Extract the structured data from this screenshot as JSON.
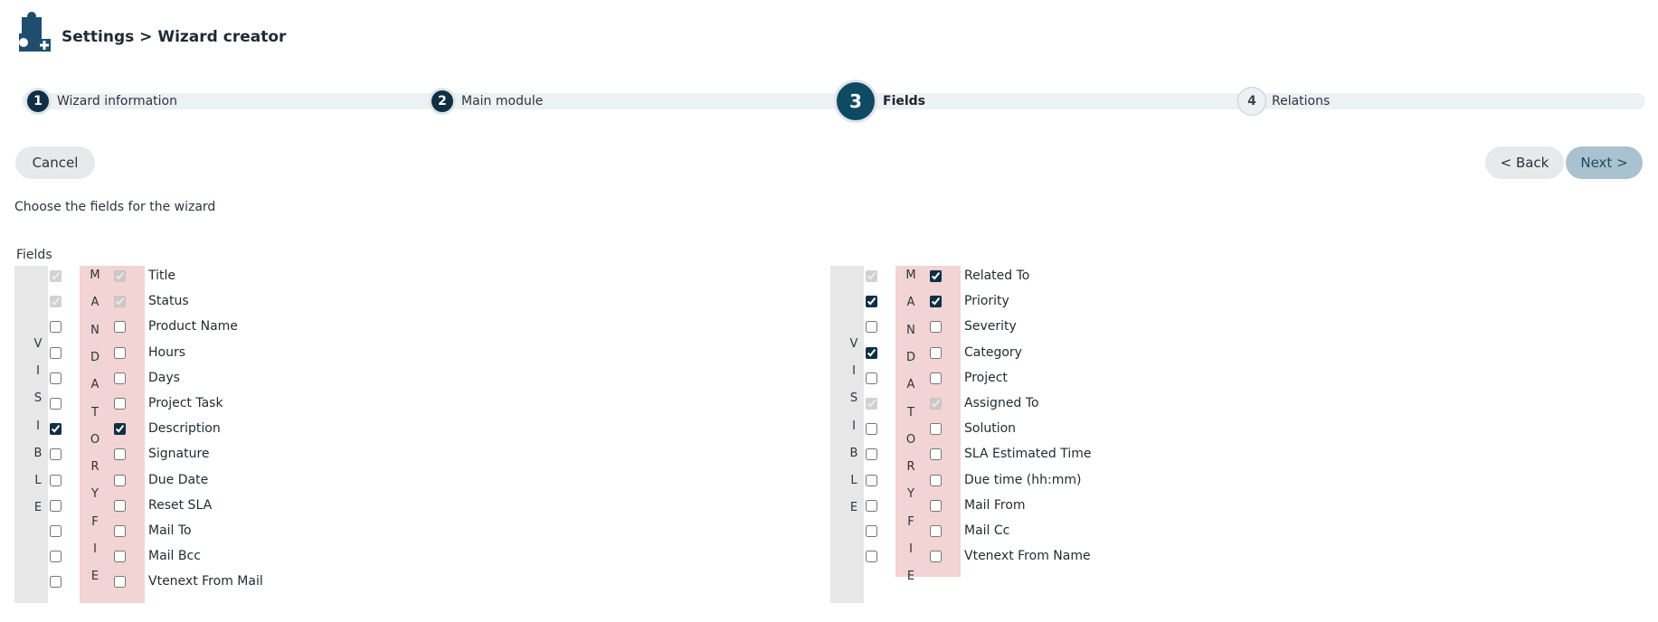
{
  "header": {
    "title": "Settings > Wizard creator",
    "logo_icon": "puzzle-plus-icon"
  },
  "steps": [
    {
      "number": "1",
      "label": "Wizard information",
      "state": "done"
    },
    {
      "number": "2",
      "label": "Main module",
      "state": "done"
    },
    {
      "number": "3",
      "label": "Fields",
      "state": "active"
    },
    {
      "number": "4",
      "label": "Relations",
      "state": "todo"
    }
  ],
  "buttons": {
    "cancel": "Cancel",
    "back": "< Back",
    "next": "Next >"
  },
  "instruction": "Choose the fields for the wizard",
  "fields_label": "Fields",
  "visible_letters": [
    "V",
    "I",
    "S",
    "I",
    "B",
    "L",
    "E"
  ],
  "mandatory_letters": [
    "M",
    "A",
    "N",
    "D",
    "A",
    "T",
    "O",
    "R",
    "Y",
    "F",
    "I",
    "E"
  ],
  "left_fields": [
    {
      "name": "Title",
      "visible": true,
      "visible_disabled": true,
      "mandatory": true,
      "mandatory_disabled": true
    },
    {
      "name": "Status",
      "visible": true,
      "visible_disabled": true,
      "mandatory": true,
      "mandatory_disabled": true
    },
    {
      "name": "Product Name",
      "visible": false,
      "visible_disabled": false,
      "mandatory": false,
      "mandatory_disabled": false
    },
    {
      "name": "Hours",
      "visible": false,
      "visible_disabled": false,
      "mandatory": false,
      "mandatory_disabled": false
    },
    {
      "name": "Days",
      "visible": false,
      "visible_disabled": false,
      "mandatory": false,
      "mandatory_disabled": false
    },
    {
      "name": "Project Task",
      "visible": false,
      "visible_disabled": false,
      "mandatory": false,
      "mandatory_disabled": false
    },
    {
      "name": "Description",
      "visible": true,
      "visible_disabled": false,
      "mandatory": true,
      "mandatory_disabled": false
    },
    {
      "name": "Signature",
      "visible": false,
      "visible_disabled": false,
      "mandatory": false,
      "mandatory_disabled": false
    },
    {
      "name": "Due Date",
      "visible": false,
      "visible_disabled": false,
      "mandatory": false,
      "mandatory_disabled": false
    },
    {
      "name": "Reset SLA",
      "visible": false,
      "visible_disabled": false,
      "mandatory": false,
      "mandatory_disabled": false
    },
    {
      "name": "Mail To",
      "visible": false,
      "visible_disabled": false,
      "mandatory": false,
      "mandatory_disabled": false
    },
    {
      "name": "Mail Bcc",
      "visible": false,
      "visible_disabled": false,
      "mandatory": false,
      "mandatory_disabled": false
    },
    {
      "name": "Vtenext From Mail",
      "visible": false,
      "visible_disabled": false,
      "mandatory": false,
      "mandatory_disabled": false
    }
  ],
  "right_fields": [
    {
      "name": "Related To",
      "visible": true,
      "visible_disabled": true,
      "mandatory": true,
      "mandatory_disabled": false
    },
    {
      "name": "Priority",
      "visible": true,
      "visible_disabled": false,
      "mandatory": true,
      "mandatory_disabled": false
    },
    {
      "name": "Severity",
      "visible": false,
      "visible_disabled": false,
      "mandatory": false,
      "mandatory_disabled": false
    },
    {
      "name": "Category",
      "visible": true,
      "visible_disabled": false,
      "mandatory": false,
      "mandatory_disabled": false
    },
    {
      "name": "Project",
      "visible": false,
      "visible_disabled": false,
      "mandatory": false,
      "mandatory_disabled": false
    },
    {
      "name": "Assigned To",
      "visible": true,
      "visible_disabled": true,
      "mandatory": true,
      "mandatory_disabled": true
    },
    {
      "name": "Solution",
      "visible": false,
      "visible_disabled": false,
      "mandatory": false,
      "mandatory_disabled": false
    },
    {
      "name": "SLA Estimated Time",
      "visible": false,
      "visible_disabled": false,
      "mandatory": false,
      "mandatory_disabled": false
    },
    {
      "name": "Due time (hh:mm)",
      "visible": false,
      "visible_disabled": false,
      "mandatory": false,
      "mandatory_disabled": false
    },
    {
      "name": "Mail From",
      "visible": false,
      "visible_disabled": false,
      "mandatory": false,
      "mandatory_disabled": false
    },
    {
      "name": "Mail Cc",
      "visible": false,
      "visible_disabled": false,
      "mandatory": false,
      "mandatory_disabled": false
    },
    {
      "name": "Vtenext From Name",
      "visible": false,
      "visible_disabled": false,
      "mandatory": false,
      "mandatory_disabled": false
    }
  ]
}
